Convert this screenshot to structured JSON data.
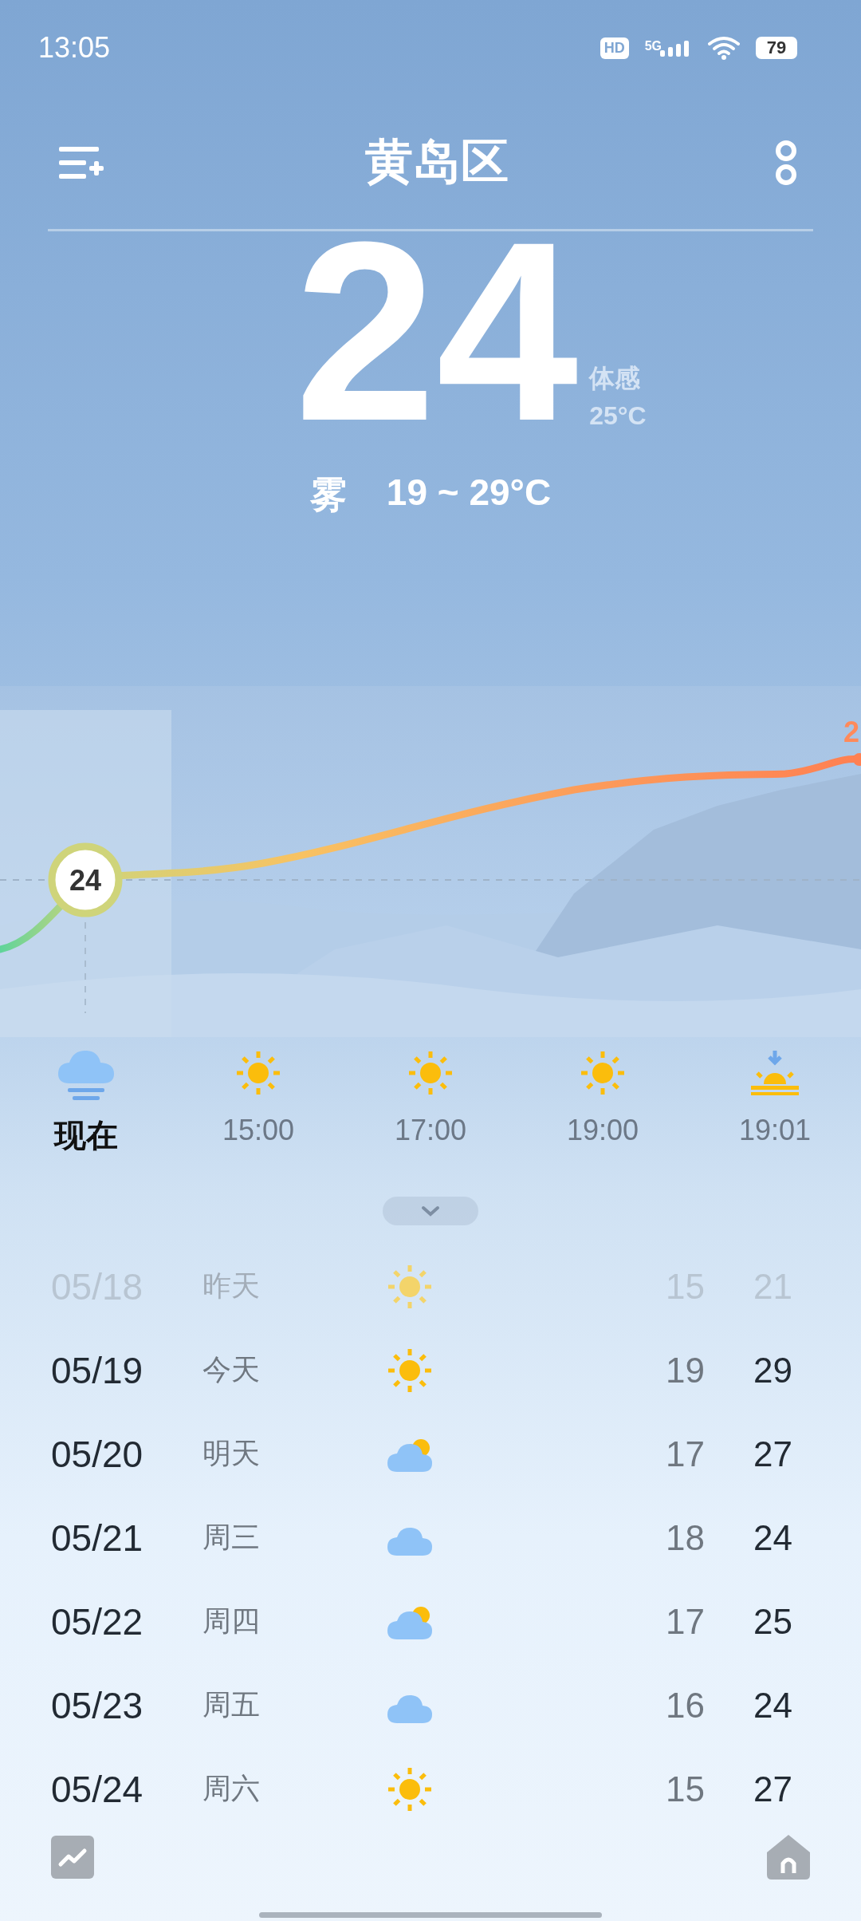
{
  "status_bar": {
    "time": "13:05",
    "hd": "HD",
    "network": "5G",
    "battery": "79"
  },
  "header": {
    "title": "黄岛区"
  },
  "current": {
    "temperature": "24",
    "feels_like_label": "体感",
    "feels_like": "25°C",
    "condition": "雾",
    "range": "19 ~ 29°C"
  },
  "chart": {
    "current_label": "24",
    "edge_label": "2"
  },
  "hourly": [
    {
      "time": "现在",
      "kind": "fog",
      "selected": true
    },
    {
      "time": "15:00",
      "kind": "sunny",
      "selected": false
    },
    {
      "time": "17:00",
      "kind": "sunny",
      "selected": false
    },
    {
      "time": "19:00",
      "kind": "sunny",
      "selected": false
    },
    {
      "time": "19:01",
      "kind": "sunset",
      "selected": false
    }
  ],
  "daily": [
    {
      "date": "05/18",
      "day": "昨天",
      "kind": "sunny",
      "low": "15",
      "high": "21",
      "past": true
    },
    {
      "date": "05/19",
      "day": "今天",
      "kind": "sunny",
      "low": "19",
      "high": "29",
      "past": false
    },
    {
      "date": "05/20",
      "day": "明天",
      "kind": "partly_cloudy",
      "low": "17",
      "high": "27",
      "past": false
    },
    {
      "date": "05/21",
      "day": "周三",
      "kind": "cloudy",
      "low": "18",
      "high": "24",
      "past": false
    },
    {
      "date": "05/22",
      "day": "周四",
      "kind": "partly_cloudy",
      "low": "17",
      "high": "25",
      "past": false
    },
    {
      "date": "05/23",
      "day": "周五",
      "kind": "cloudy",
      "low": "16",
      "high": "24",
      "past": false
    },
    {
      "date": "05/24",
      "day": "周六",
      "kind": "sunny",
      "low": "15",
      "high": "27",
      "past": false
    }
  ]
}
